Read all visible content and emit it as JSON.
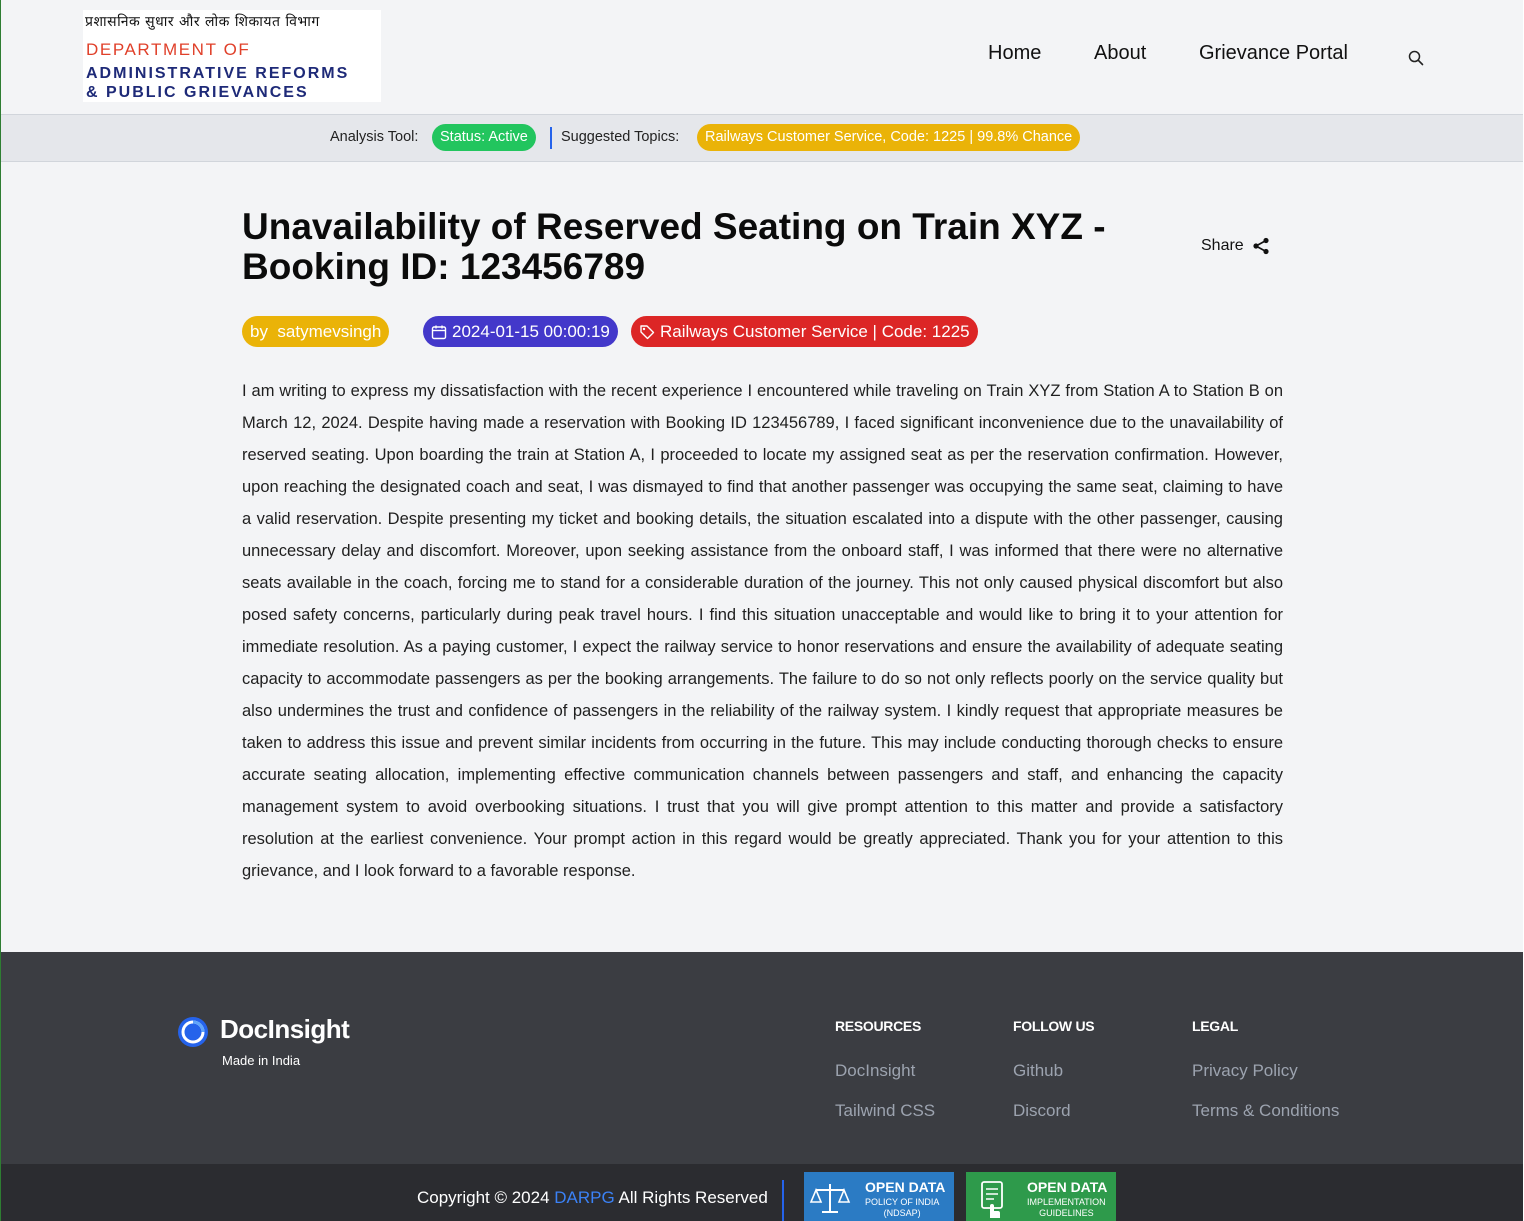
{
  "header": {
    "logo": {
      "hindi": "प्रशासनिक सुधार और लोक शिकायत विभाग",
      "line1": "DEPARTMENT OF",
      "line2": "ADMINISTRATIVE REFORMS",
      "line3": "& PUBLIC GRIEVANCES"
    },
    "nav": [
      {
        "label": "Home"
      },
      {
        "label": "About"
      },
      {
        "label": "Grievance Portal"
      }
    ],
    "search_icon": "search-icon"
  },
  "analysis_bar": {
    "tool_label": "Analysis Tool:",
    "status": "Status: Active",
    "topics_label": "Suggested Topics:",
    "topic": "Railways Customer Service, Code: 1225 | 99.8% Chance",
    "colors": {
      "status": "#22c55e",
      "topic": "#eab308",
      "divider": "#2563eb"
    }
  },
  "grievance": {
    "title": "Unavailability of Reserved Seating on Train XYZ - Booking ID: 123456789",
    "share_label": "Share",
    "author": "by  satymevsingh",
    "date": "2024-01-15 00:00:19",
    "category": "Railways Customer Service | Code: 1225",
    "tag_colors": {
      "author": "#eab308",
      "date": "#4338ca",
      "category": "#dc2626"
    },
    "body": "I am writing to express my dissatisfaction with the recent experience I encountered while traveling on Train XYZ from Station A to Station B on March 12, 2024. Despite having made a reservation with Booking ID 123456789, I faced significant inconvenience due to the unavailability of reserved seating. Upon boarding the train at Station A, I proceeded to locate my assigned seat as per the reservation confirmation. However, upon reaching the designated coach and seat, I was dismayed to find that another passenger was occupying the same seat, claiming to have a valid reservation. Despite presenting my ticket and booking details, the situation escalated into a dispute with the other passenger, causing unnecessary delay and discomfort. Moreover, upon seeking assistance from the onboard staff, I was informed that there were no alternative seats available in the coach, forcing me to stand for a considerable duration of the journey. This not only caused physical discomfort but also posed safety concerns, particularly during peak travel hours. I find this situation unacceptable and would like to bring it to your attention for immediate resolution. As a paying customer, I expect the railway service to honor reservations and ensure the availability of adequate seating capacity to accommodate passengers as per the booking arrangements. The failure to do so not only reflects poorly on the service quality but also undermines the trust and confidence of passengers in the reliability of the railway system. I kindly request that appropriate measures be taken to address this issue and prevent similar incidents from occurring in the future. This may include conducting thorough checks to ensure accurate seating allocation, implementing effective communication channels between passengers and staff, and enhancing the capacity management system to avoid overbooking situations. I trust that you will give prompt attention to this matter and provide a satisfactory resolution at the earliest convenience. Your prompt action in this regard would be greatly appreciated. Thank you for your attention to this grievance, and I look forward to a favorable response."
  },
  "footer": {
    "brand": "DocInsight",
    "tagline": "Made in India",
    "columns": [
      {
        "heading": "RESOURCES",
        "links": [
          "DocInsight",
          "Tailwind CSS"
        ]
      },
      {
        "heading": "FOLLOW US",
        "links": [
          "Github",
          "Discord"
        ]
      },
      {
        "heading": "LEGAL",
        "links": [
          "Privacy Policy",
          "Terms & Conditions"
        ]
      }
    ],
    "copyright_prefix": "Copyright © 2024 ",
    "copyright_org": "DARPG",
    "copyright_suffix": " All Rights Reserved",
    "badges": [
      {
        "title": "OPEN DATA",
        "sub1": "POLICY OF INDIA",
        "sub2": "(NDSAP)",
        "color": "#2b7bc4"
      },
      {
        "title": "OPEN DATA",
        "sub1": "IMPLEMENTATION",
        "sub2": "GUIDELINES",
        "color": "#2e9a4b"
      }
    ]
  }
}
